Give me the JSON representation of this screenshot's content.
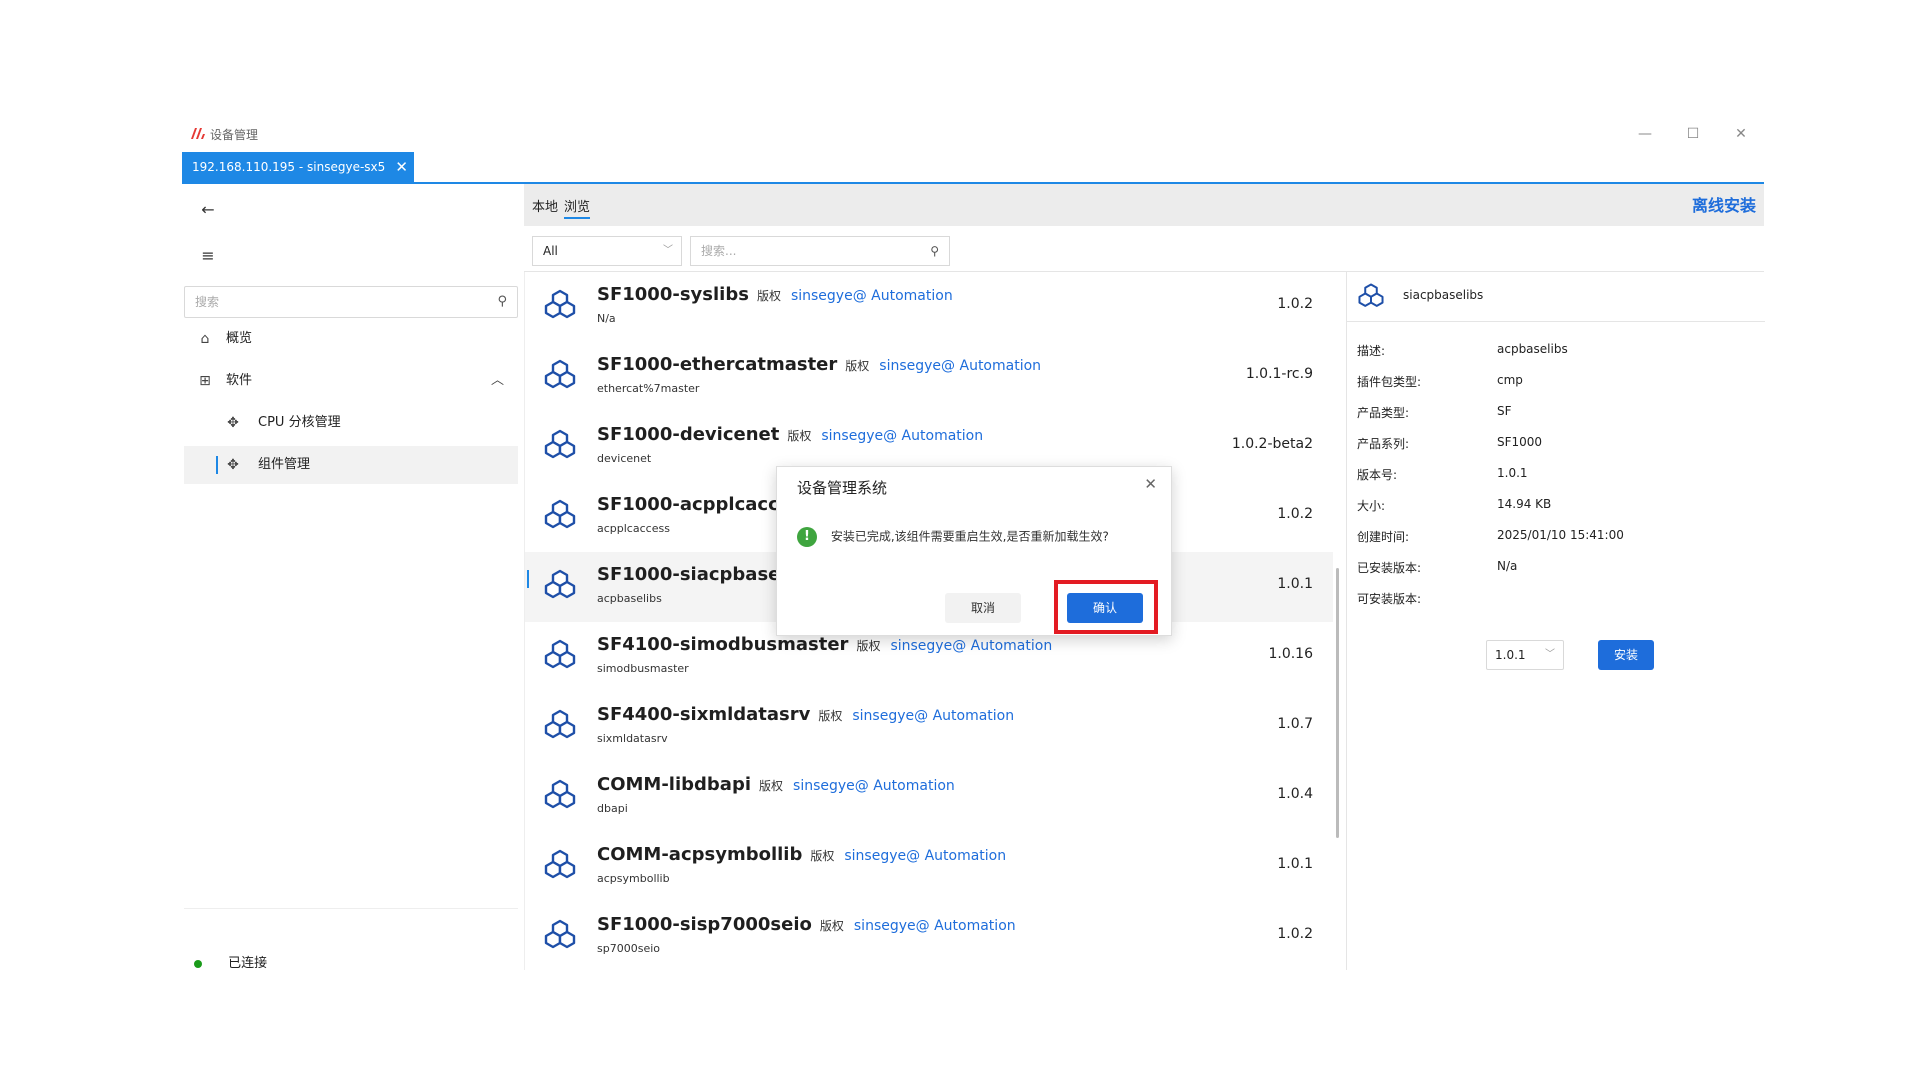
{
  "window": {
    "title": "设备管理",
    "tab": "192.168.110.195 - sinsegye-sx5"
  },
  "nav": {
    "search_placeholder": "搜索",
    "items": [
      {
        "label": "概览",
        "icon": "home-icon"
      },
      {
        "label": "软件",
        "icon": "grid-icon"
      },
      {
        "label": "CPU 分核管理",
        "icon": "puzzle-icon"
      },
      {
        "label": "组件管理",
        "icon": "puzzle-icon"
      }
    ],
    "status": "已连接"
  },
  "main": {
    "tabs": [
      "本地",
      "浏览"
    ],
    "offline_install": "离线安装",
    "filter_value": "All",
    "search_placeholder": "搜索..."
  },
  "packages": [
    {
      "name": "SF1000-syslibs",
      "copyright": "版权",
      "author": "sinsegye@ Automation",
      "sub": "N/a",
      "version": "1.0.2"
    },
    {
      "name": "SF1000-ethercatmaster",
      "copyright": "版权",
      "author": "sinsegye@ Automation",
      "sub": "ethercat%7master",
      "version": "1.0.1-rc.9"
    },
    {
      "name": "SF1000-devicenet",
      "copyright": "版权",
      "author": "sinsegye@ Automation",
      "sub": "devicenet",
      "version": "1.0.2-beta2"
    },
    {
      "name": "SF1000-acpplcacc",
      "copyright": "",
      "author": "",
      "sub": "acpplcaccess",
      "version": "1.0.2"
    },
    {
      "name": "SF1000-siacpbasel",
      "copyright": "",
      "author": "",
      "sub": "acpbaselibs",
      "version": "1.0.1"
    },
    {
      "name": "SF4100-simodbusmaster",
      "copyright": "版权",
      "author": "sinsegye@ Automation",
      "sub": "simodbusmaster",
      "version": "1.0.16"
    },
    {
      "name": "SF4400-sixmldatasrv",
      "copyright": "版权",
      "author": "sinsegye@ Automation",
      "sub": "sixmldatasrv",
      "version": "1.0.7"
    },
    {
      "name": "COMM-libdbapi",
      "copyright": "版权",
      "author": "sinsegye@ Automation",
      "sub": "dbapi",
      "version": "1.0.4"
    },
    {
      "name": "COMM-acpsymbollib",
      "copyright": "版权",
      "author": "sinsegye@ Automation",
      "sub": "acpsymbollib",
      "version": "1.0.1"
    },
    {
      "name": "SF1000-sisp7000seio",
      "copyright": "版权",
      "author": "sinsegye@ Automation",
      "sub": "sp7000seio",
      "version": "1.0.2"
    }
  ],
  "detail": {
    "name": "siacpbaselibs",
    "fields": [
      {
        "k": "描述:",
        "v": "acpbaselibs"
      },
      {
        "k": "插件包类型:",
        "v": "cmp"
      },
      {
        "k": "产品类型:",
        "v": "SF"
      },
      {
        "k": "产品系列:",
        "v": "SF1000"
      },
      {
        "k": "版本号:",
        "v": "1.0.1"
      },
      {
        "k": "大小:",
        "v": "14.94 KB"
      },
      {
        "k": "创建时间:",
        "v": "2025/01/10 15:41:00"
      },
      {
        "k": "已安装版本:",
        "v": "N/a"
      },
      {
        "k": "可安装版本:",
        "v": ""
      }
    ],
    "version_select": "1.0.1",
    "install": "安装"
  },
  "dialog": {
    "title": "设备管理系统",
    "message": "安装已完成,该组件需要重启生效,是否重新加载生效?",
    "cancel": "取消",
    "ok": "确认"
  },
  "colors": {
    "accent": "#1e88e5",
    "link": "#1e6ddb",
    "highlight": "#e31b23",
    "connected": "#1a9b1a"
  }
}
